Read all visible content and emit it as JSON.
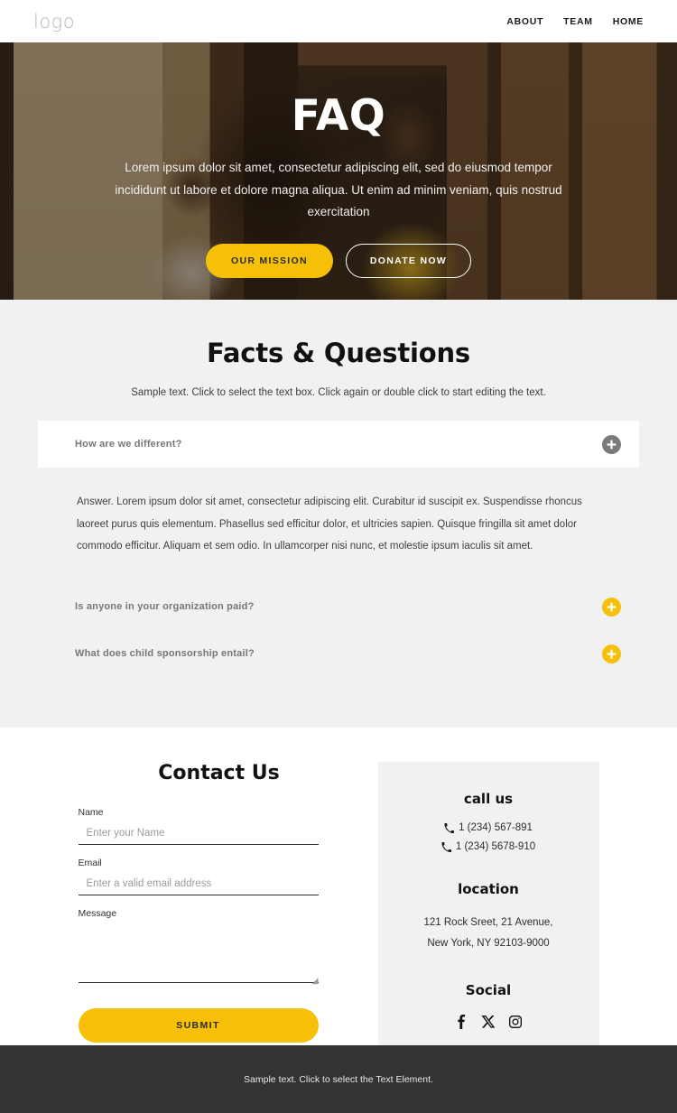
{
  "header": {
    "logo": "logo",
    "nav": [
      {
        "label": "ABOUT"
      },
      {
        "label": "TEAM"
      },
      {
        "label": "HOME"
      }
    ]
  },
  "hero": {
    "title": "FAQ",
    "subtitle": "Lorem ipsum dolor sit amet, consectetur adipiscing elit, sed do eiusmod tempor incididunt ut labore et dolore magna aliqua. Ut enim ad minim veniam, quis nostrud exercitation",
    "primary_button": "OUR MISSION",
    "secondary_button": "DONATE NOW",
    "accent_color": "#f6c009"
  },
  "faq": {
    "title": "Facts & Questions",
    "subtitle": "Sample text. Click to select the text box. Click again or double click to start editing the text.",
    "items": [
      {
        "question": "How are we different?",
        "expanded": true,
        "icon": "plus-icon",
        "icon_color": "#7a7a7a",
        "answer": "Answer. Lorem ipsum dolor sit amet, consectetur adipiscing elit. Curabitur id suscipit ex. Suspendisse rhoncus laoreet purus quis elementum. Phasellus sed efficitur dolor, et ultricies sapien. Quisque fringilla sit amet dolor commodo efficitur. Aliquam et sem odio. In ullamcorper nisi nunc, et molestie ipsum iaculis sit amet."
      },
      {
        "question": "Is anyone in your organization paid?",
        "expanded": false,
        "icon": "plus-icon",
        "icon_color": "#f6c009",
        "answer": ""
      },
      {
        "question": "What does child sponsorship entail?",
        "expanded": false,
        "icon": "plus-icon",
        "icon_color": "#f6c009",
        "answer": ""
      }
    ]
  },
  "contact": {
    "heading": "Contact Us",
    "name_label": "Name",
    "name_placeholder": "Enter your Name",
    "name_value": "",
    "email_label": "Email",
    "email_placeholder": "Enter a valid email address",
    "email_value": "",
    "message_label": "Message",
    "message_placeholder": "",
    "message_value": "",
    "submit_label": "SUBMIT"
  },
  "info": {
    "call_heading": "call us",
    "phones": [
      "1 (234) 567-891",
      "1 (234) 5678-910"
    ],
    "location_heading": "location",
    "address_lines": [
      "121 Rock Sreet, 21 Avenue,",
      "New York, NY 92103-9000"
    ],
    "social_heading": "Social",
    "social": [
      {
        "name": "facebook-icon"
      },
      {
        "name": "x-twitter-icon"
      },
      {
        "name": "instagram-icon"
      }
    ]
  },
  "footer": {
    "text": "Sample text. Click to select the Text Element."
  }
}
